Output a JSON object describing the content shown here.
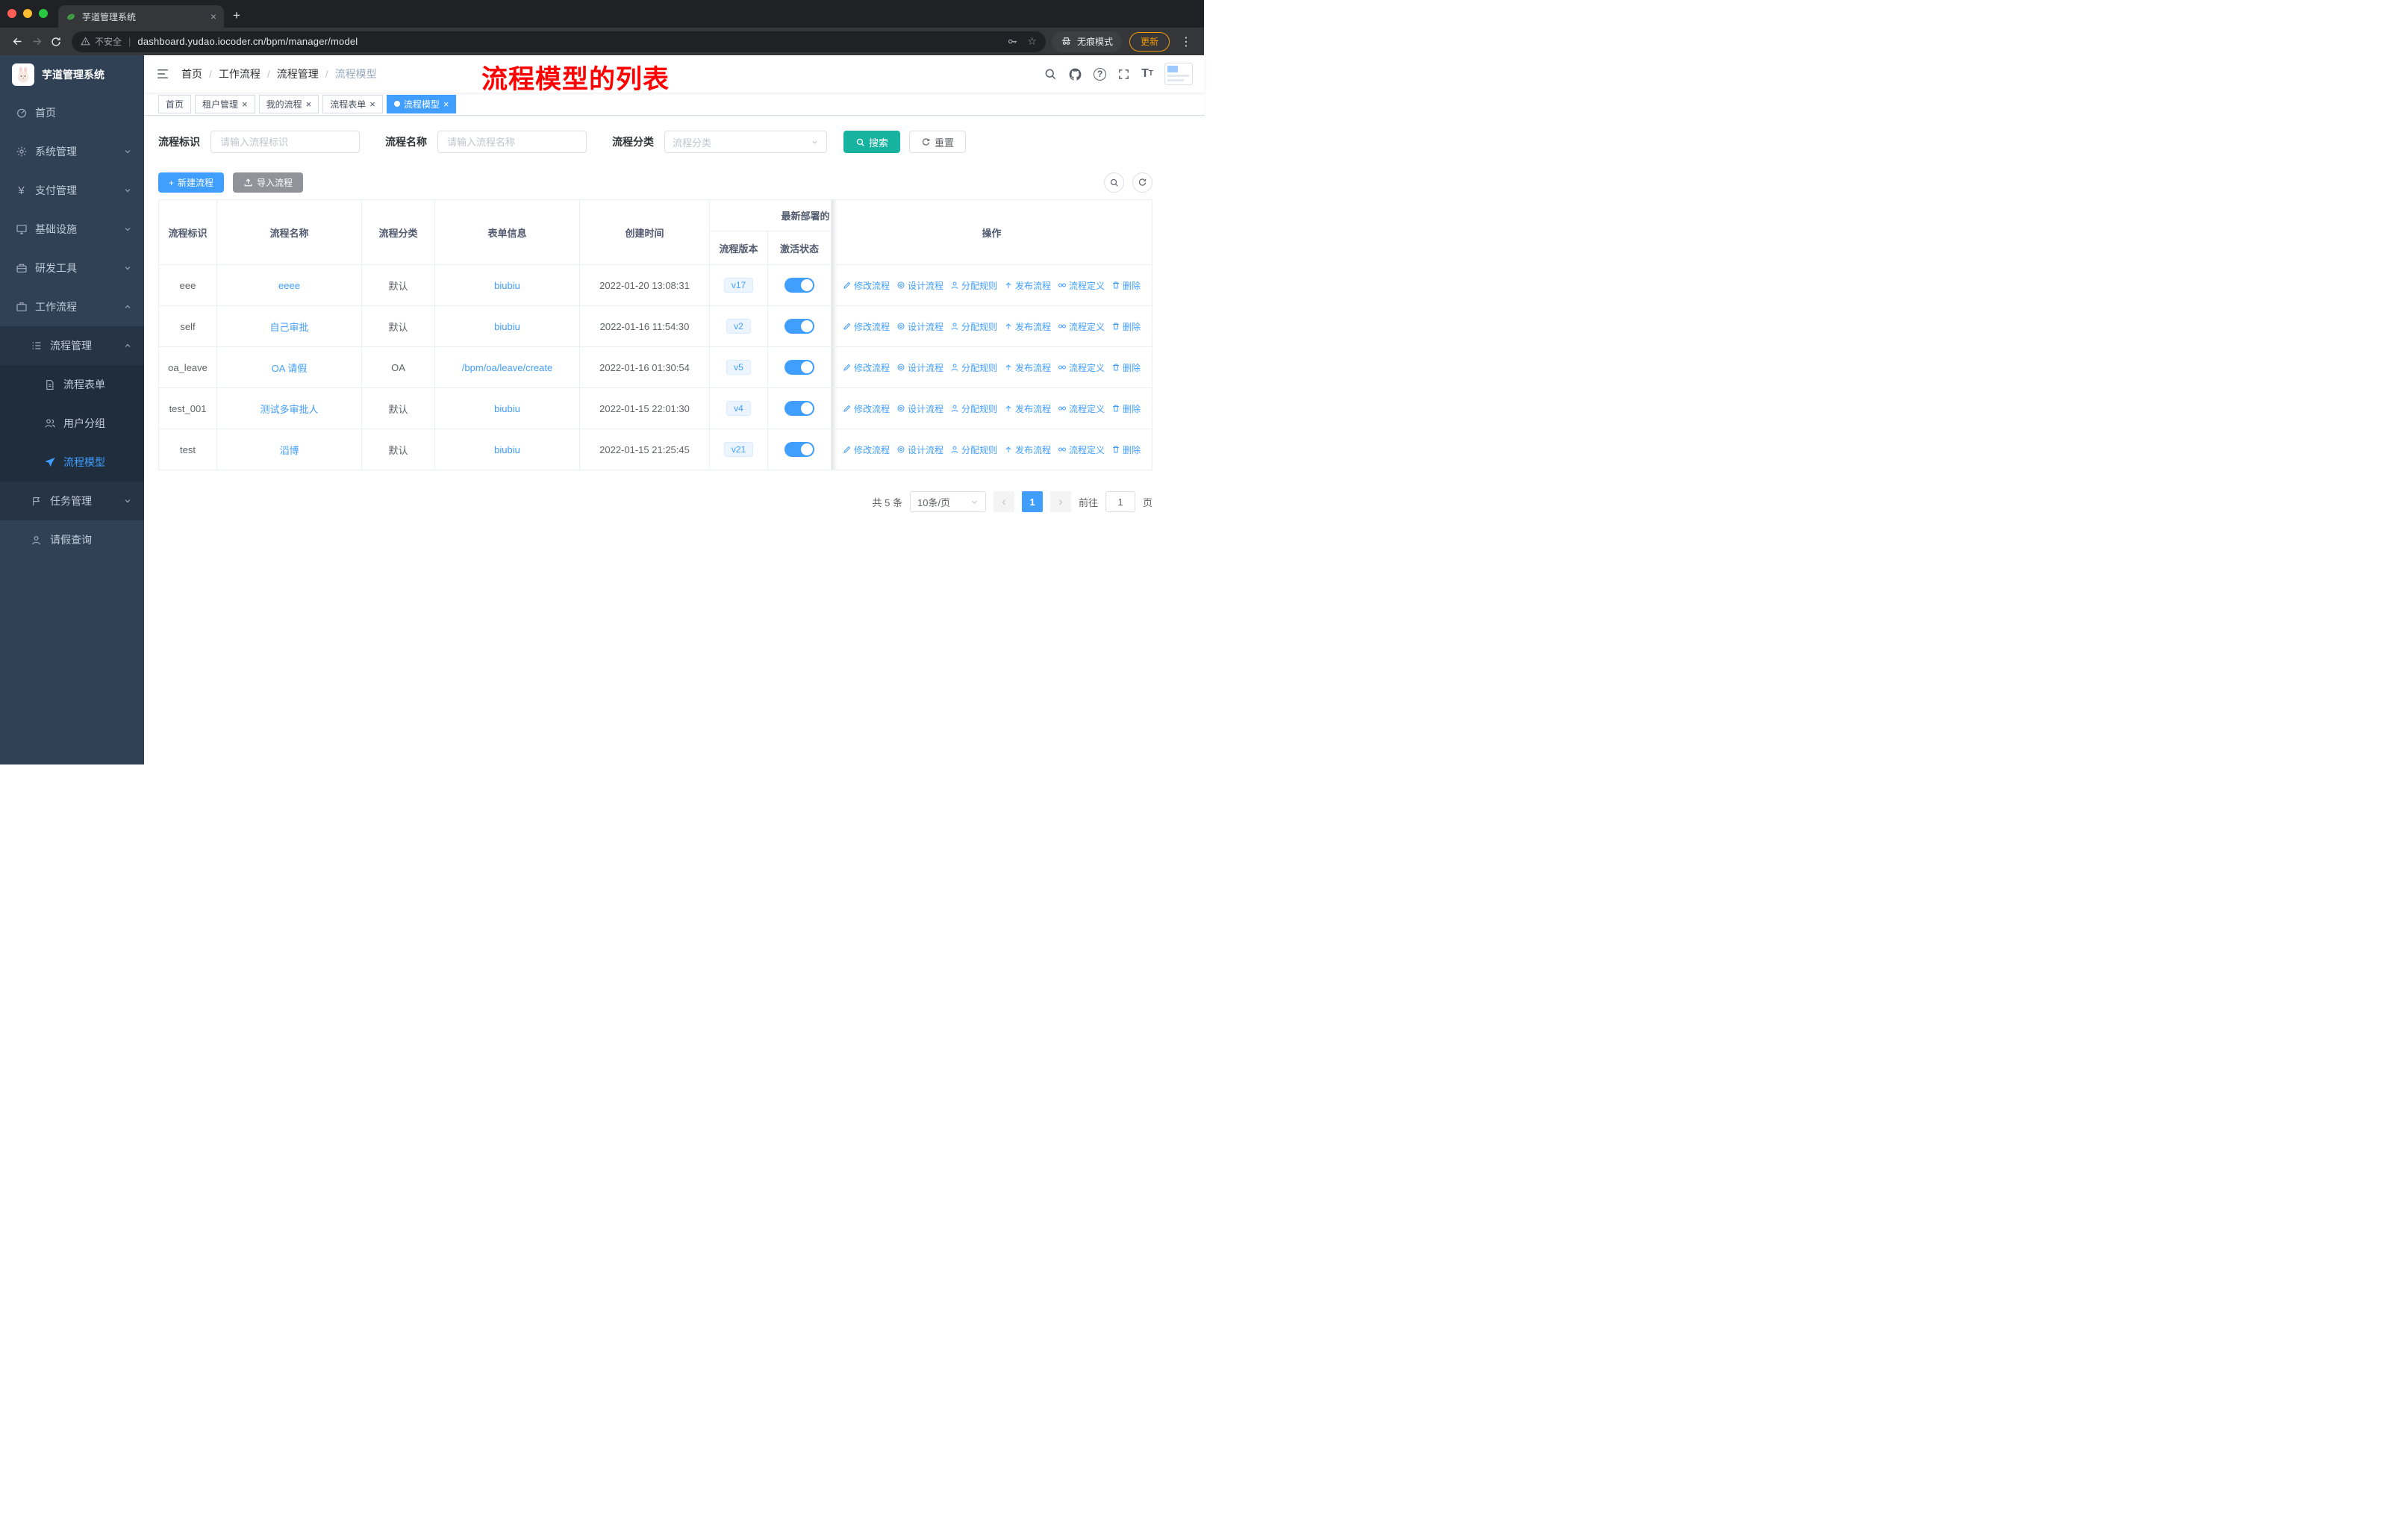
{
  "colors": {
    "primary": "#409eff",
    "search_button": "#16b3a0",
    "sidebar_bg": "#304156",
    "sidebar_active_text": "#409eff",
    "annotation_red": "#ff0000"
  },
  "browser": {
    "tab_title": "芋道管理系统",
    "security_label": "不安全",
    "url": "dashboard.yudao.iocoder.cn/bpm/manager/model",
    "incognito_label": "无痕模式",
    "update_label": "更新"
  },
  "sidebar": {
    "logo_title": "芋道管理系统",
    "menu": [
      {
        "label": "首页",
        "icon": "dashboard-icon"
      },
      {
        "label": "系统管理",
        "icon": "gear-icon"
      },
      {
        "label": "支付管理",
        "icon": "yen-icon"
      },
      {
        "label": "基础设施",
        "icon": "monitor-icon"
      },
      {
        "label": "研发工具",
        "icon": "toolbox-icon"
      },
      {
        "label": "工作流程",
        "icon": "briefcase-icon"
      },
      {
        "label": "流程管理",
        "icon": "list-tree-icon"
      },
      {
        "label": "流程表单",
        "icon": "document-icon"
      },
      {
        "label": "用户分组",
        "icon": "users-icon"
      },
      {
        "label": "流程模型",
        "icon": "paper-plane-icon"
      },
      {
        "label": "任务管理",
        "icon": "flag-icon"
      },
      {
        "label": "请假查询",
        "icon": "person-icon"
      }
    ]
  },
  "header": {
    "breadcrumb": [
      "首页",
      "工作流程",
      "流程管理",
      "流程模型"
    ],
    "annotation": "流程模型的列表"
  },
  "tags": [
    {
      "label": "首页"
    },
    {
      "label": "租户管理"
    },
    {
      "label": "我的流程"
    },
    {
      "label": "流程表单"
    },
    {
      "label": "流程模型"
    }
  ],
  "filters": {
    "id_label": "流程标识",
    "id_placeholder": "请输入流程标识",
    "name_label": "流程名称",
    "name_placeholder": "请输入流程名称",
    "category_label": "流程分类",
    "category_placeholder": "流程分类",
    "search_label": "搜索",
    "reset_label": "重置"
  },
  "toolbar": {
    "create_label": "新建流程",
    "import_label": "导入流程"
  },
  "table": {
    "headers": {
      "id": "流程标识",
      "name": "流程名称",
      "category": "流程分类",
      "form": "表单信息",
      "created": "创建时间",
      "deploy_group": "最新部署的",
      "version": "流程版本",
      "active": "激活状态",
      "ops": "操作"
    },
    "rows": [
      {
        "id": "eee",
        "name": "eeee",
        "category": "默认",
        "form": "biubiu",
        "created": "2022-01-20 13:08:31",
        "version": "v17",
        "active": true
      },
      {
        "id": "self",
        "name": "自己审批",
        "category": "默认",
        "form": "biubiu",
        "created": "2022-01-16 11:54:30",
        "version": "v2",
        "active": true
      },
      {
        "id": "oa_leave",
        "name": "OA 请假",
        "category": "OA",
        "form": "/bpm/oa/leave/create",
        "created": "2022-01-16 01:30:54",
        "version": "v5",
        "active": true
      },
      {
        "id": "test_001",
        "name": "测试多审批人",
        "category": "默认",
        "form": "biubiu",
        "created": "2022-01-15 22:01:30",
        "version": "v4",
        "active": true
      },
      {
        "id": "test",
        "name": "滔博",
        "category": "默认",
        "form": "biubiu",
        "created": "2022-01-15 21:25:45",
        "version": "v21",
        "active": true
      }
    ],
    "ops": [
      {
        "label": "修改流程",
        "icon": "edit-icon"
      },
      {
        "label": "设计流程",
        "icon": "design-icon"
      },
      {
        "label": "分配规则",
        "icon": "assign-icon"
      },
      {
        "label": "发布流程",
        "icon": "publish-icon"
      },
      {
        "label": "流程定义",
        "icon": "definition-icon"
      },
      {
        "label": "删除",
        "icon": "trash-icon"
      }
    ]
  },
  "pagination": {
    "total": "共 5 条",
    "page_size": "10条/页",
    "current_page": "1",
    "goto_label": "前往",
    "goto_value": "1",
    "page_label": "页"
  },
  "icons": {
    "close": "×",
    "more-vertical": "⋮",
    "star": "☆",
    "plus": "+",
    "question": "?",
    "divider": "|",
    "prev": "‹",
    "next": "›",
    "yen": "¥"
  }
}
